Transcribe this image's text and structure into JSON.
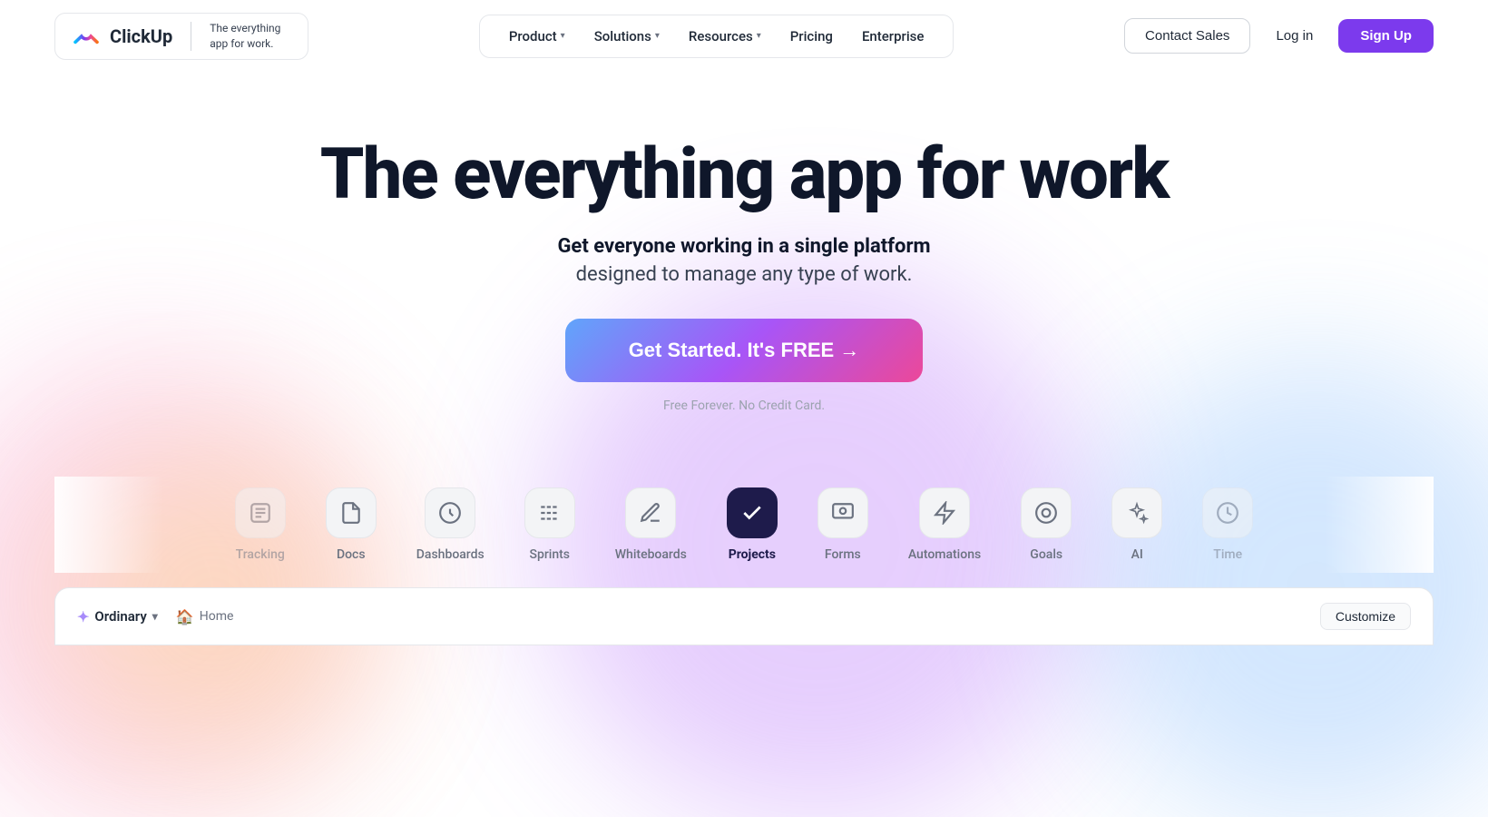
{
  "nav": {
    "logo_text": "ClickUp",
    "tagline": "The everything app for work.",
    "links": [
      {
        "label": "Product",
        "has_chevron": true
      },
      {
        "label": "Solutions",
        "has_chevron": true
      },
      {
        "label": "Resources",
        "has_chevron": true
      },
      {
        "label": "Pricing",
        "has_chevron": false
      },
      {
        "label": "Enterprise",
        "has_chevron": false
      }
    ],
    "contact_sales": "Contact Sales",
    "login": "Log in",
    "signup": "Sign Up"
  },
  "hero": {
    "title": "The everything app for work",
    "subtitle_bold": "Get everyone working in a single platform",
    "subtitle": "designed to manage any type of work.",
    "cta_button": "Get Started. It's FREE →",
    "free_note": "Free Forever. No Credit Card."
  },
  "feature_tabs": [
    {
      "id": "tracking",
      "label": "Tracking",
      "icon": "📋",
      "active": false,
      "partial": true
    },
    {
      "id": "docs",
      "label": "Docs",
      "icon": "📄",
      "active": false
    },
    {
      "id": "dashboards",
      "label": "Dashboards",
      "icon": "🎧",
      "active": false
    },
    {
      "id": "sprints",
      "label": "Sprints",
      "icon": "〰",
      "active": false
    },
    {
      "id": "whiteboards",
      "label": "Whiteboards",
      "icon": "✏️",
      "active": false
    },
    {
      "id": "projects",
      "label": "Projects",
      "icon": "✔",
      "active": true
    },
    {
      "id": "forms",
      "label": "Forms",
      "icon": "🖥",
      "active": false
    },
    {
      "id": "automations",
      "label": "Automations",
      "icon": "⚡",
      "active": false
    },
    {
      "id": "goals",
      "label": "Goals",
      "icon": "◎",
      "active": false
    },
    {
      "id": "ai",
      "label": "AI",
      "icon": "✦",
      "active": false
    },
    {
      "id": "time",
      "label": "Time",
      "icon": "⏰",
      "active": false,
      "partial": true
    }
  ],
  "bottom_panel": {
    "workspace_label": "Ordinary",
    "home_label": "Home",
    "customize_label": "Customize"
  }
}
